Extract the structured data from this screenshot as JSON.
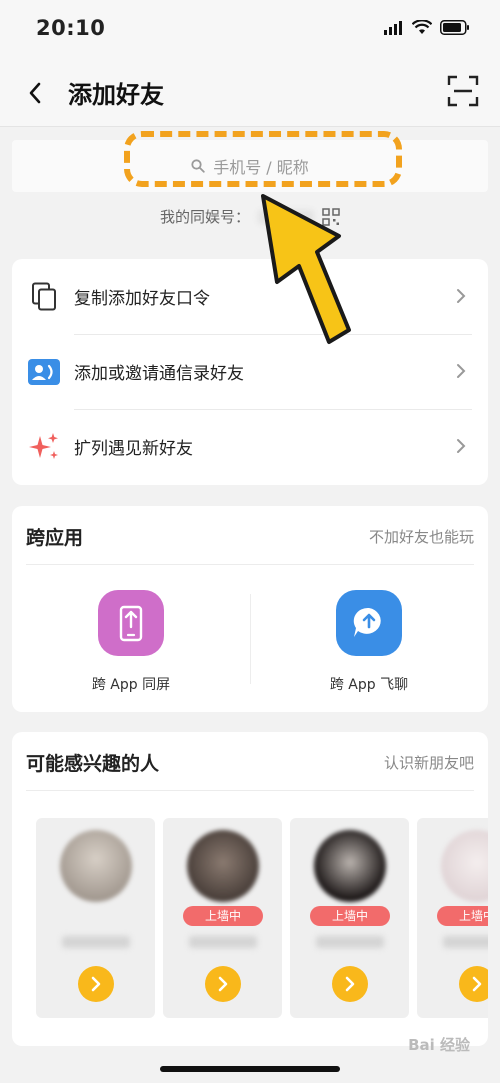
{
  "status_bar": {
    "time": "20:10",
    "icons": [
      "signal-icon",
      "wifi-icon",
      "battery-icon"
    ]
  },
  "nav": {
    "title": "添加好友",
    "back_icon": "chevron-left-icon",
    "scan_icon": "scan-icon"
  },
  "search": {
    "placeholder": "手机号 / 昵称",
    "icon": "search-icon"
  },
  "my_id": {
    "label": "我的同娱号："
  },
  "actions": [
    {
      "label": "复制添加好友口令",
      "icon": "copy-icon"
    },
    {
      "label": "添加或邀请通信录好友",
      "icon": "contacts-icon"
    },
    {
      "label": "扩列遇见新好友",
      "icon": "sparkle-icon"
    }
  ],
  "cross_app": {
    "title": "跨应用",
    "subtitle": "不加好友也能玩",
    "apps": [
      {
        "label": "跨 App 同屏",
        "icon": "screen-share-icon",
        "color": "#cf6ec9"
      },
      {
        "label": "跨 App 飞聊",
        "icon": "chat-bubble-icon",
        "color": "#3a8ee6"
      }
    ]
  },
  "suggested": {
    "title": "可能感兴趣的人",
    "subtitle": "认识新朋友吧",
    "people": [
      {
        "badge": ""
      },
      {
        "badge": "上墙中"
      },
      {
        "badge": "上墙中"
      },
      {
        "badge": "上墙中"
      }
    ]
  },
  "colors": {
    "accent": "#f9b81b",
    "badge": "#f26b6b",
    "highlight": "#f2a21e"
  },
  "watermark": "Bai 经验"
}
